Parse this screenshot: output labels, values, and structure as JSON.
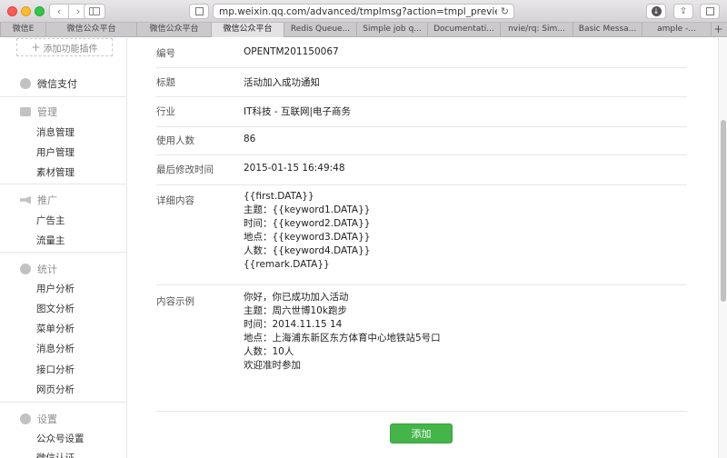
{
  "browser": {
    "url": "mp.weixin.qq.com/advanced/tmplmsg?action=tmpl_preview&t=tmplmsg/previ",
    "tabs": [
      {
        "label": "微信E",
        "width": 50
      },
      {
        "label": "微信公众平台",
        "width": 100
      },
      {
        "label": "微信公众平台",
        "width": 82
      },
      {
        "label": "微信公众平台",
        "width": 80,
        "active": true
      },
      {
        "label": "Redis Queue...",
        "width": 80
      },
      {
        "label": "Simple job q...",
        "width": 78
      },
      {
        "label": "Documentati...",
        "width": 80
      },
      {
        "label": "nvie/rq: Sim...",
        "width": 80
      },
      {
        "label": "Basic Messa...",
        "width": 76
      },
      {
        "label": "ample -...",
        "width": 76
      }
    ],
    "new_tab": "+"
  },
  "sidebar": {
    "add_plugin": "添加功能插件",
    "wechat_pay": "微信支付",
    "groups": [
      {
        "title": "管理",
        "icon": "inbox-icon",
        "items": [
          "消息管理",
          "用户管理",
          "素材管理"
        ]
      },
      {
        "title": "推广",
        "icon": "megaphone-icon",
        "items": [
          "广告主",
          "流量主"
        ]
      },
      {
        "title": "统计",
        "icon": "pie-chart-icon",
        "items": [
          "用户分析",
          "图文分析",
          "菜单分析",
          "消息分析",
          "接口分析",
          "网页分析"
        ]
      },
      {
        "title": "设置",
        "icon": "gear-icon",
        "items": [
          "公众号设置",
          "微信认证"
        ]
      }
    ]
  },
  "template": {
    "fields": [
      {
        "label": "编号",
        "value": "OPENTM201150067"
      },
      {
        "label": "标题",
        "value": "活动加入成功通知"
      },
      {
        "label": "行业",
        "value": "IT科技 - 互联网|电子商务"
      },
      {
        "label": "使用人数",
        "value": "86"
      },
      {
        "label": "最后修改时间",
        "value": "2015-01-15 16:49:48"
      }
    ],
    "detail_label": "详细内容",
    "detail_lines": [
      "{{first.DATA}}",
      "主题：{{keyword1.DATA}}",
      "时间：{{keyword2.DATA}}",
      "地点：{{keyword3.DATA}}",
      "人数：{{keyword4.DATA}}",
      "{{remark.DATA}}"
    ],
    "example_label": "内容示例",
    "example_lines": [
      "你好，你已成功加入活动",
      "主题：周六世博10k跑步",
      "时间：2014.11.15 14",
      "地点：上海浦东新区东方体育中心地铁站5号口",
      "人数：10人",
      "欢迎准时参加"
    ],
    "add_button": "添加"
  },
  "colors": {
    "accent": "#44b549"
  }
}
